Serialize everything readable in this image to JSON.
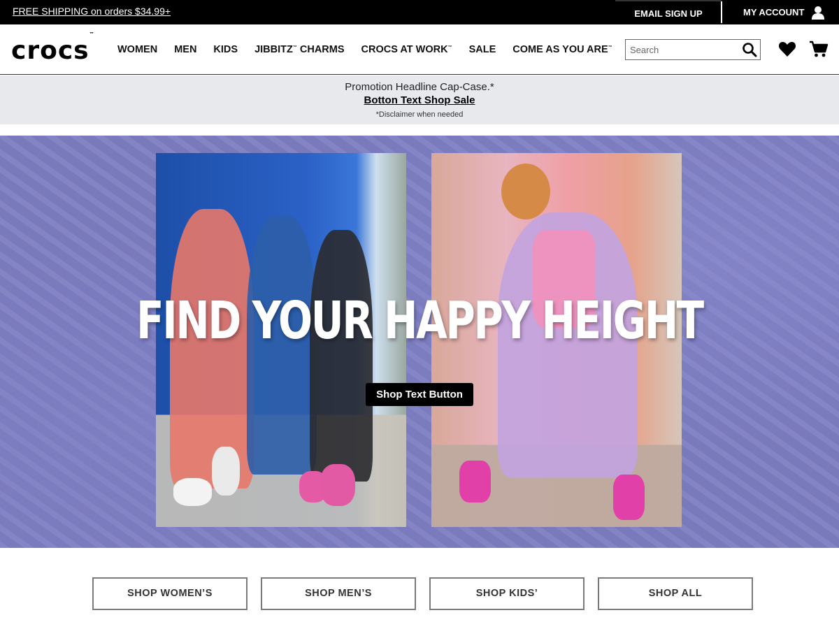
{
  "topbar": {
    "free_shipping": "FREE SHIPPING on orders $34.99+",
    "email_signup": "EMAIL SIGN UP",
    "my_account": "MY ACCOUNT"
  },
  "nav": {
    "logo": "crocs",
    "logo_tm": "™",
    "links": [
      {
        "label": "WOMEN",
        "tm": ""
      },
      {
        "label": "MEN",
        "tm": ""
      },
      {
        "label": "KIDS",
        "tm": ""
      },
      {
        "label": "JIBBITZ",
        "tm": "™",
        "suffix": " CHARMS"
      },
      {
        "label": "CROCS AT WORK",
        "tm": "™"
      },
      {
        "label": "SALE",
        "tm": ""
      },
      {
        "label": "COME AS YOU ARE",
        "tm": "™"
      }
    ],
    "search_placeholder": "Search",
    "icons": [
      "search-icon",
      "heart-icon",
      "cart-icon",
      "user-icon"
    ]
  },
  "promo": {
    "headline": "Promotion Headline Cap-Case.*",
    "link": "Botton Text Shop Sale",
    "disclaimer": "*Disclaimer when needed"
  },
  "hero": {
    "headline": "FIND YOUR HAPPY HEIGHT",
    "cta": "Shop Text Button",
    "background_color": "#7d7ec2"
  },
  "shop_buttons": [
    "SHOP WOMEN’S",
    "SHOP MEN’S",
    "SHOP KIDS’",
    "SHOP ALL"
  ]
}
